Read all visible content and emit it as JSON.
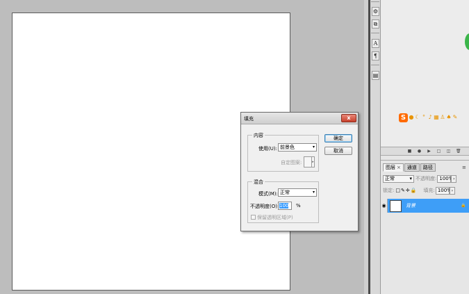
{
  "dialog": {
    "title": "填充",
    "close_glyph": "x",
    "content_group": "内容",
    "use_label": "使用(U):",
    "use_value": "前景色",
    "custom_pattern_label": "自定图案:",
    "blend_group": "混合",
    "mode_label": "模式(M):",
    "mode_value": "正常",
    "opacity_label": "不透明度(O):",
    "opacity_value": "100",
    "opacity_unit": "%",
    "preserve_label": "保留透明区域(P)",
    "ok_label": "确定",
    "cancel_label": "取消"
  },
  "layers_panel": {
    "tabs": [
      "图层",
      "通道",
      "路径"
    ],
    "tab_close": "×",
    "blend_mode": "正常",
    "opacity_label": "不透明度:",
    "opacity_value": "100%",
    "lock_label": "锁定:",
    "fill_label": "填充:",
    "fill_value": "100%",
    "layer_name": "背景"
  },
  "colors": {
    "workspace": "#bdbdbd",
    "layer_selected": "#3e9ef7",
    "close_button": "#c8402b",
    "ime_logo": "#ff6a00"
  }
}
